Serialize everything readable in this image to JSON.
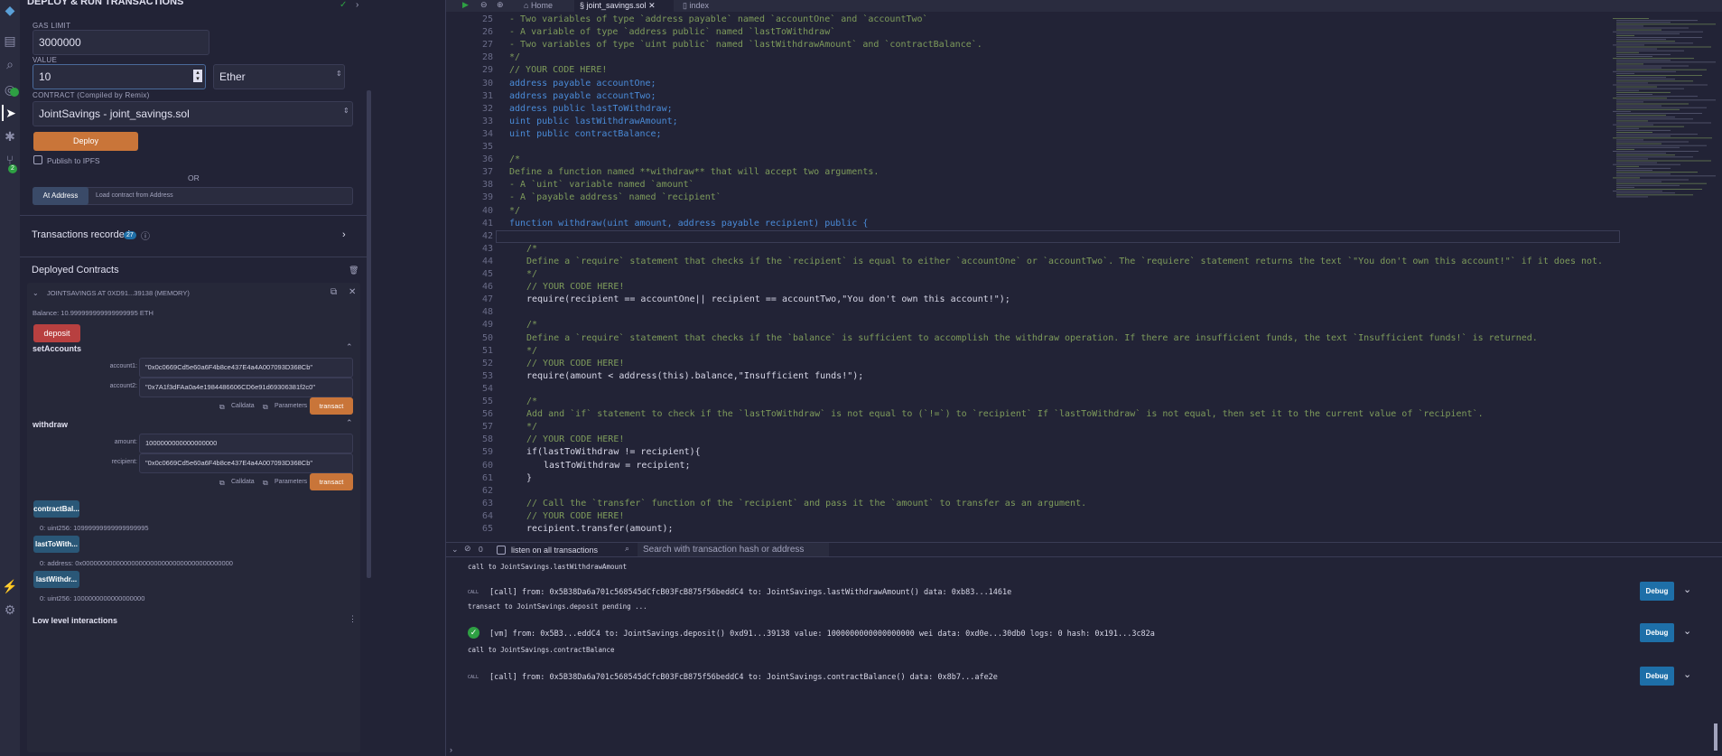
{
  "rail": {
    "icons": [
      "remix-logo-icon",
      "file-explorer-icon",
      "search-icon",
      "compiler-icon",
      "deploy-run-icon",
      "debugger-icon",
      "git-icon",
      "plugin-icon",
      "settings-icon"
    ],
    "git_badge": "2"
  },
  "panel": {
    "header_title": "DEPLOY & RUN TRANSACTIONS",
    "gas_limit_label": "GAS LIMIT",
    "gas_limit_value": "3000000",
    "value_label": "VALUE",
    "value_amount": "10",
    "value_unit": "Ether",
    "contract_label": "CONTRACT (Compiled by Remix)",
    "contract_value": "JointSavings - joint_savings.sol",
    "deploy_label": "Deploy",
    "publish_label": "Publish to IPFS",
    "or_label": "OR",
    "at_address_label": "At Address",
    "at_address_placeholder": "Load contract from Address",
    "transactions_recorded_label": "Transactions recorded",
    "transactions_recorded_count": "27",
    "deployed_contracts_label": "Deployed Contracts",
    "instance_title": "JOINTSAVINGS AT 0XD91...39138 (MEMORY)",
    "balance_text": "Balance: 10.999999999999999995 ETH",
    "deposit_label": "deposit",
    "set_accounts_label": "setAccounts",
    "account1_label": "account1:",
    "account1_value": "\"0x0c0669Cd5e60a6F4b8ce437E4a4A007093D368Cb\"",
    "account2_label": "account2:",
    "account2_value": "\"0x7A1f3dFAa0a4e1984486606CD6e91d69306381f2c0\"",
    "calldata_label": "Calldata",
    "parameters_label": "Parameters",
    "transact_label": "transact",
    "withdraw_label": "withdraw",
    "amount_label": "amount:",
    "amount_value": "1000000000000000000",
    "recipient_label": "recipient:",
    "recipient_value": "\"0x0c0669Cd5e60a6F4b8ce437E4a4A007093D368Cb\"",
    "contract_balance_btn": "contractBal...",
    "contract_balance_result": "0: uint256: 10999999999999999995",
    "last_to_withdraw_btn": "lastToWith...",
    "last_to_withdraw_result": "0: address: 0x0000000000000000000000000000000000000000",
    "last_withdraw_amount_btn": "lastWithdr...",
    "last_withdraw_amount_result": "0: uint256: 1000000000000000000",
    "low_level_label": "Low level interactions"
  },
  "tabs": [
    {
      "label": "Home"
    },
    {
      "label": "joint_savings.sol"
    },
    {
      "label": "index"
    }
  ],
  "code": [
    {
      "n": "25",
      "t": "- Two variables of type `address payable` named `accountOne` and `accountTwo`",
      "c": "cm",
      "i": 0
    },
    {
      "n": "26",
      "t": "- A variable of type `address public` named `lastToWithdraw`",
      "c": "cm",
      "i": 0
    },
    {
      "n": "27",
      "t": "- Two variables of type `uint public` named `lastWithdrawAmount` and `contractBalance`.",
      "c": "cm",
      "i": 0
    },
    {
      "n": "28",
      "t": "*/",
      "c": "cm",
      "i": 0
    },
    {
      "n": "29",
      "t": "// YOUR CODE HERE!",
      "c": "cm",
      "i": 0
    },
    {
      "n": "30",
      "t": "address payable accountOne;",
      "c": "kw",
      "i": 0
    },
    {
      "n": "31",
      "t": "address payable accountTwo;",
      "c": "kw",
      "i": 0
    },
    {
      "n": "32",
      "t": "address public lastToWithdraw;",
      "c": "kw",
      "i": 0
    },
    {
      "n": "33",
      "t": "uint public lastWithdrawAmount;",
      "c": "kw",
      "i": 0
    },
    {
      "n": "34",
      "t": "uint public contractBalance;",
      "c": "kw",
      "i": 0
    },
    {
      "n": "35",
      "t": "",
      "c": "tx",
      "i": 0
    },
    {
      "n": "36",
      "t": "/*",
      "c": "cm",
      "i": 0
    },
    {
      "n": "37",
      "t": "Define a function named **withdraw** that will accept two arguments.",
      "c": "cm",
      "i": 0
    },
    {
      "n": "38",
      "t": "- A `uint` variable named `amount`",
      "c": "cm",
      "i": 0
    },
    {
      "n": "39",
      "t": "- A `payable address` named `recipient`",
      "c": "cm",
      "i": 0
    },
    {
      "n": "40",
      "t": "*/",
      "c": "cm",
      "i": 0
    },
    {
      "n": "41",
      "t": "function withdraw(uint amount, address payable recipient) public {",
      "c": "kw",
      "i": 0
    },
    {
      "n": "42",
      "t": "",
      "c": "tx",
      "i": 0
    },
    {
      "n": "43",
      "t": "/*",
      "c": "cm",
      "i": 1
    },
    {
      "n": "44",
      "t": "Define a `require` statement that checks if the `recipient` is equal to either `accountOne` or `accountTwo`. The `requiere` statement returns the text `\"You don't own this account!\"` if it does not.",
      "c": "cm",
      "i": 1
    },
    {
      "n": "45",
      "t": "*/",
      "c": "cm",
      "i": 1
    },
    {
      "n": "46",
      "t": "// YOUR CODE HERE!",
      "c": "cm",
      "i": 1
    },
    {
      "n": "47",
      "t": "require(recipient == accountOne|| recipient == accountTwo,\"You don't own this account!\");",
      "c": "tx",
      "i": 1
    },
    {
      "n": "48",
      "t": "",
      "c": "tx",
      "i": 1
    },
    {
      "n": "49",
      "t": "/*",
      "c": "cm",
      "i": 1
    },
    {
      "n": "50",
      "t": "Define a `require` statement that checks if the `balance` is sufficient to accomplish the withdraw operation. If there are insufficient funds, the text `Insufficient funds!` is returned.",
      "c": "cm",
      "i": 1
    },
    {
      "n": "51",
      "t": "*/",
      "c": "cm",
      "i": 1
    },
    {
      "n": "52",
      "t": "// YOUR CODE HERE!",
      "c": "cm",
      "i": 1
    },
    {
      "n": "53",
      "t": "require(amount < address(this).balance,\"Insufficient funds!\");",
      "c": "tx",
      "i": 1
    },
    {
      "n": "54",
      "t": "",
      "c": "tx",
      "i": 1
    },
    {
      "n": "55",
      "t": "/*",
      "c": "cm",
      "i": 1
    },
    {
      "n": "56",
      "t": "Add and `if` statement to check if the `lastToWithdraw` is not equal to (`!=`) to `recipient` If `lastToWithdraw` is not equal, then set it to the current value of `recipient`.",
      "c": "cm",
      "i": 1
    },
    {
      "n": "57",
      "t": "*/",
      "c": "cm",
      "i": 1
    },
    {
      "n": "58",
      "t": "// YOUR CODE HERE!",
      "c": "cm",
      "i": 1
    },
    {
      "n": "59",
      "t": "if(lastToWithdraw != recipient){",
      "c": "tx",
      "i": 1
    },
    {
      "n": "60",
      "t": "lastToWithdraw = recipient;",
      "c": "tx",
      "i": 2
    },
    {
      "n": "61",
      "t": "}",
      "c": "tx",
      "i": 1
    },
    {
      "n": "62",
      "t": "",
      "c": "tx",
      "i": 1
    },
    {
      "n": "63",
      "t": "// Call the `transfer` function of the `recipient` and pass it the `amount` to transfer as an argument.",
      "c": "cm",
      "i": 1
    },
    {
      "n": "64",
      "t": "// YOUR CODE HERE!",
      "c": "cm",
      "i": 1
    },
    {
      "n": "65",
      "t": "recipient.transfer(amount);",
      "c": "tx",
      "i": 1
    }
  ],
  "terminal": {
    "count": "0",
    "listen_label": "listen on all transactions",
    "search_placeholder": "Search with transaction hash or address",
    "lines": [
      {
        "kind": "plain",
        "text": "call to JointSavings.lastWithdrawAmount"
      },
      {
        "kind": "call",
        "tag": "CALL",
        "text": "[call] from: 0x5B38Da6a701c568545dCfcB03FcB875f56beddC4 to: JointSavings.lastWithdrawAmount() data: 0xb83...1461e",
        "debug": "Debug"
      },
      {
        "kind": "plain",
        "text": "transact to JointSavings.deposit pending ..."
      },
      {
        "kind": "ok",
        "text": "[vm] from: 0x5B3...eddC4 to: JointSavings.deposit() 0xd91...39138 value: 1000000000000000000 wei data: 0xd0e...30db0 logs: 0 hash: 0x191...3c82a",
        "debug": "Debug"
      },
      {
        "kind": "plain",
        "text": "call to JointSavings.contractBalance"
      },
      {
        "kind": "call",
        "tag": "CALL",
        "text": "[call] from: 0x5B38Da6a701c568545dCfcB03FcB875f56beddC4 to: JointSavings.contractBalance() data: 0x8b7...afe2e",
        "debug": "Debug"
      }
    ]
  },
  "colors": {
    "accent_orange": "#c97539",
    "deposit_red": "#b84040",
    "call_blue": "#2a5777",
    "debug_blue": "#1e6fa8",
    "success_green": "#2ea043"
  }
}
